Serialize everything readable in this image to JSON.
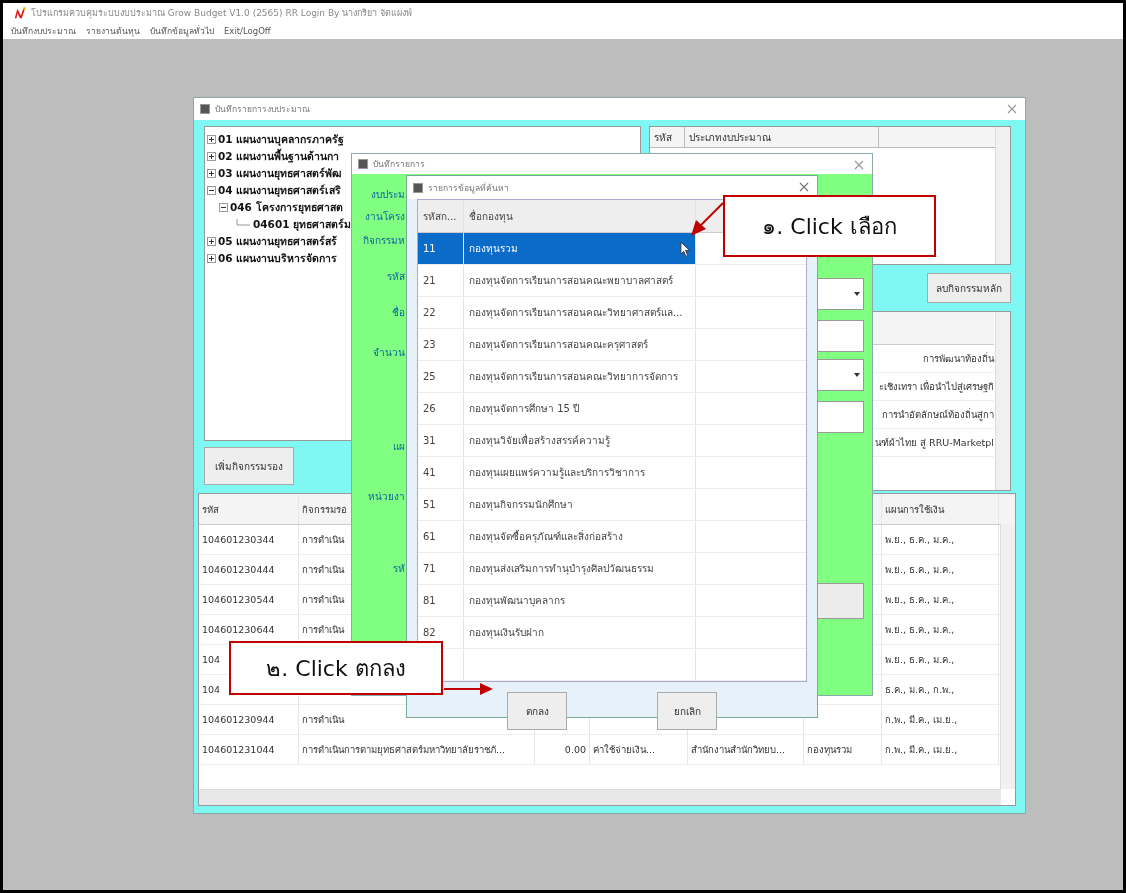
{
  "app": {
    "title": "โปรแกรมควบคุมระบบงบประมาณ Grow Budget V1.0 (2565) RR  Login By นางกริยา จัดแผงพ์",
    "menu": [
      "บันทึกงบประมาณ",
      "รายงานต้นทุน",
      "บันทึกข้อมูลทั่วไป",
      "Exit/LogOff"
    ]
  },
  "main_form": {
    "title": "บันทึกรายการงบประมาณ",
    "tree": [
      {
        "label": "01 แผนงานบุคลากรภาครัฐ",
        "expanded": false
      },
      {
        "label": "02 แผนงานพื้นฐานด้านกา",
        "expanded": false
      },
      {
        "label": "03 แผนงานยุทธศาสตร์พัฒ",
        "expanded": false
      },
      {
        "label": "04 แผนงานยุทธศาสตร์เสริ",
        "expanded": true,
        "children": [
          {
            "label": "046 โครงการยุทธศาสต",
            "expanded": true,
            "children": [
              {
                "label": "04601 ยุทธศาสตร์ม"
              }
            ]
          }
        ]
      },
      {
        "label": "05 แผนงานยุทธศาสตร์สร้",
        "expanded": false
      },
      {
        "label": "06 แผนงานบริหารจัดการ",
        "expanded": false
      }
    ],
    "budget_type_grid": {
      "columns": [
        "รหัส",
        "ประเภทงบประมาณ"
      ]
    },
    "delete_main_button": "ลบกิจกรรมหลัก",
    "activity_list": [
      "การพัฒนาท้องถิ่น",
      "ะเชิงเทรา เพื่อนำไปสู่เศรษฐกิ",
      "การนำอัตลักษณ์ท้องถิ่นสู่กา",
      "นฑ์ผ้าไทย สู่ RRU-Marketpl"
    ],
    "add_sub_button": "เพิ่มกิจกรรมรอง",
    "activities_table": {
      "columns": [
        "รหัส",
        "กิจกรรมรอ",
        "แผนการใช้เงิน"
      ],
      "rows": [
        {
          "code": "104601230344",
          "activity": "การดำเนิน",
          "plan": "พ.ย., ธ.ค., ม.ค.,"
        },
        {
          "code": "104601230444",
          "activity": "การดำเนิน",
          "plan": "พ.ย., ธ.ค., ม.ค.,"
        },
        {
          "code": "104601230544",
          "activity": "การดำเนิน",
          "plan": "พ.ย., ธ.ค., ม.ค.,"
        },
        {
          "code": "104601230644",
          "activity": "การดำเนิน",
          "plan": "พ.ย., ธ.ค., ม.ค.,"
        },
        {
          "code": "104",
          "plan": "พ.ย., ธ.ค., ม.ค.,"
        },
        {
          "code": "104",
          "plan": "ธ.ค., ม.ค., ก.พ.,"
        },
        {
          "code": "104601230944",
          "activity": "การดำเนิน",
          "plan": "ก.พ., มี.ค., เม.ย.,"
        },
        {
          "code": "104601231044",
          "activity": "การดำเนินการตามยุทธศาสตร์มหาวิทยาลัยราชภั...",
          "amount": "0.00",
          "expense": "ค่าใช้จ่ายเงิน...",
          "unit": "สำนักงานสำนักวิทยบ...",
          "fund": "กองทุนรวม",
          "plan": "ก.พ., มี.ค., เม.ย.,"
        }
      ]
    }
  },
  "sub_activity_dialog": {
    "title": "บันทึกรายการ",
    "labels": [
      "งบประม",
      "งานโครง",
      "กิจกรรมห",
      "รหัส",
      "ชื่อ",
      "จำนวน",
      "แผ",
      "หน่วยงา",
      "รหั"
    ]
  },
  "search_dialog": {
    "title": "รายการข้อมูลที่ค้นหา",
    "columns": [
      "รหัสก...",
      "ชื่อกองทุน"
    ],
    "rows": [
      {
        "code": "11",
        "name": "กองทุนรวม",
        "selected": true
      },
      {
        "code": "21",
        "name": "กองทุนจัดการเรียนการสอนคณะพยาบาลศาสตร์",
        "selected": false
      },
      {
        "code": "22",
        "name": "กองทุนจัดการเรียนการสอนคณะวิทยาศาสตร์แล...",
        "selected": false
      },
      {
        "code": "23",
        "name": "กองทุนจัดการเรียนการสอนคณะครุศาสตร์",
        "selected": false
      },
      {
        "code": "25",
        "name": "กองทุนจัดการเรียนการสอนคณะวิทยาการจัดการ",
        "selected": false
      },
      {
        "code": "26",
        "name": "กองทุนจัดการศึกษา 15 ปี",
        "selected": false
      },
      {
        "code": "31",
        "name": "กองทุนวิจัยเพื่อสร้างสรรค์ความรู้",
        "selected": false
      },
      {
        "code": "41",
        "name": "กองทุนเผยแพร่ความรู้และบริการวิชาการ",
        "selected": false
      },
      {
        "code": "51",
        "name": "กองทุนกิจกรรมนักศึกษา",
        "selected": false
      },
      {
        "code": "61",
        "name": "กองทุนจัดซื้อครุภัณฑ์และสิ่งก่อสร้าง",
        "selected": false
      },
      {
        "code": "71",
        "name": "กองทุนส่งเสริมการทำนุบำรุงศิลปวัฒนธรรม",
        "selected": false
      },
      {
        "code": "81",
        "name": "กองทุนพัฒนาบุคลากร",
        "selected": false
      },
      {
        "code": "82",
        "name": "กองทุนเงินรับฝาก",
        "selected": false
      }
    ],
    "buttons": [
      "ตกลง",
      "ยกเลิก"
    ]
  },
  "annotations": [
    "๑. Click เลือก",
    "๒. Click ตกลง"
  ]
}
